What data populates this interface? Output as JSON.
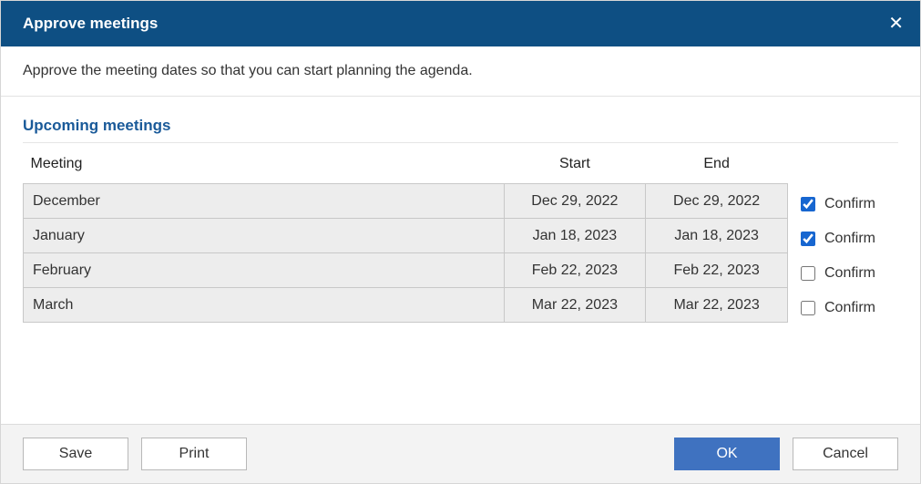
{
  "title": "Approve meetings",
  "instructions": "Approve the meeting dates so that you can start planning the agenda.",
  "section_title": "Upcoming meetings",
  "columns": {
    "meeting": "Meeting",
    "start": "Start",
    "end": "End"
  },
  "confirm_label": "Confirm",
  "rows": [
    {
      "meeting": "December",
      "start": "Dec 29, 2022",
      "end": "Dec 29, 2022",
      "confirmed": true
    },
    {
      "meeting": "January",
      "start": "Jan 18, 2023",
      "end": "Jan 18, 2023",
      "confirmed": true
    },
    {
      "meeting": "February",
      "start": "Feb 22, 2023",
      "end": "Feb 22, 2023",
      "confirmed": false
    },
    {
      "meeting": "March",
      "start": "Mar 22, 2023",
      "end": "Mar 22, 2023",
      "confirmed": false
    }
  ],
  "buttons": {
    "save": "Save",
    "print": "Print",
    "ok": "OK",
    "cancel": "Cancel"
  }
}
